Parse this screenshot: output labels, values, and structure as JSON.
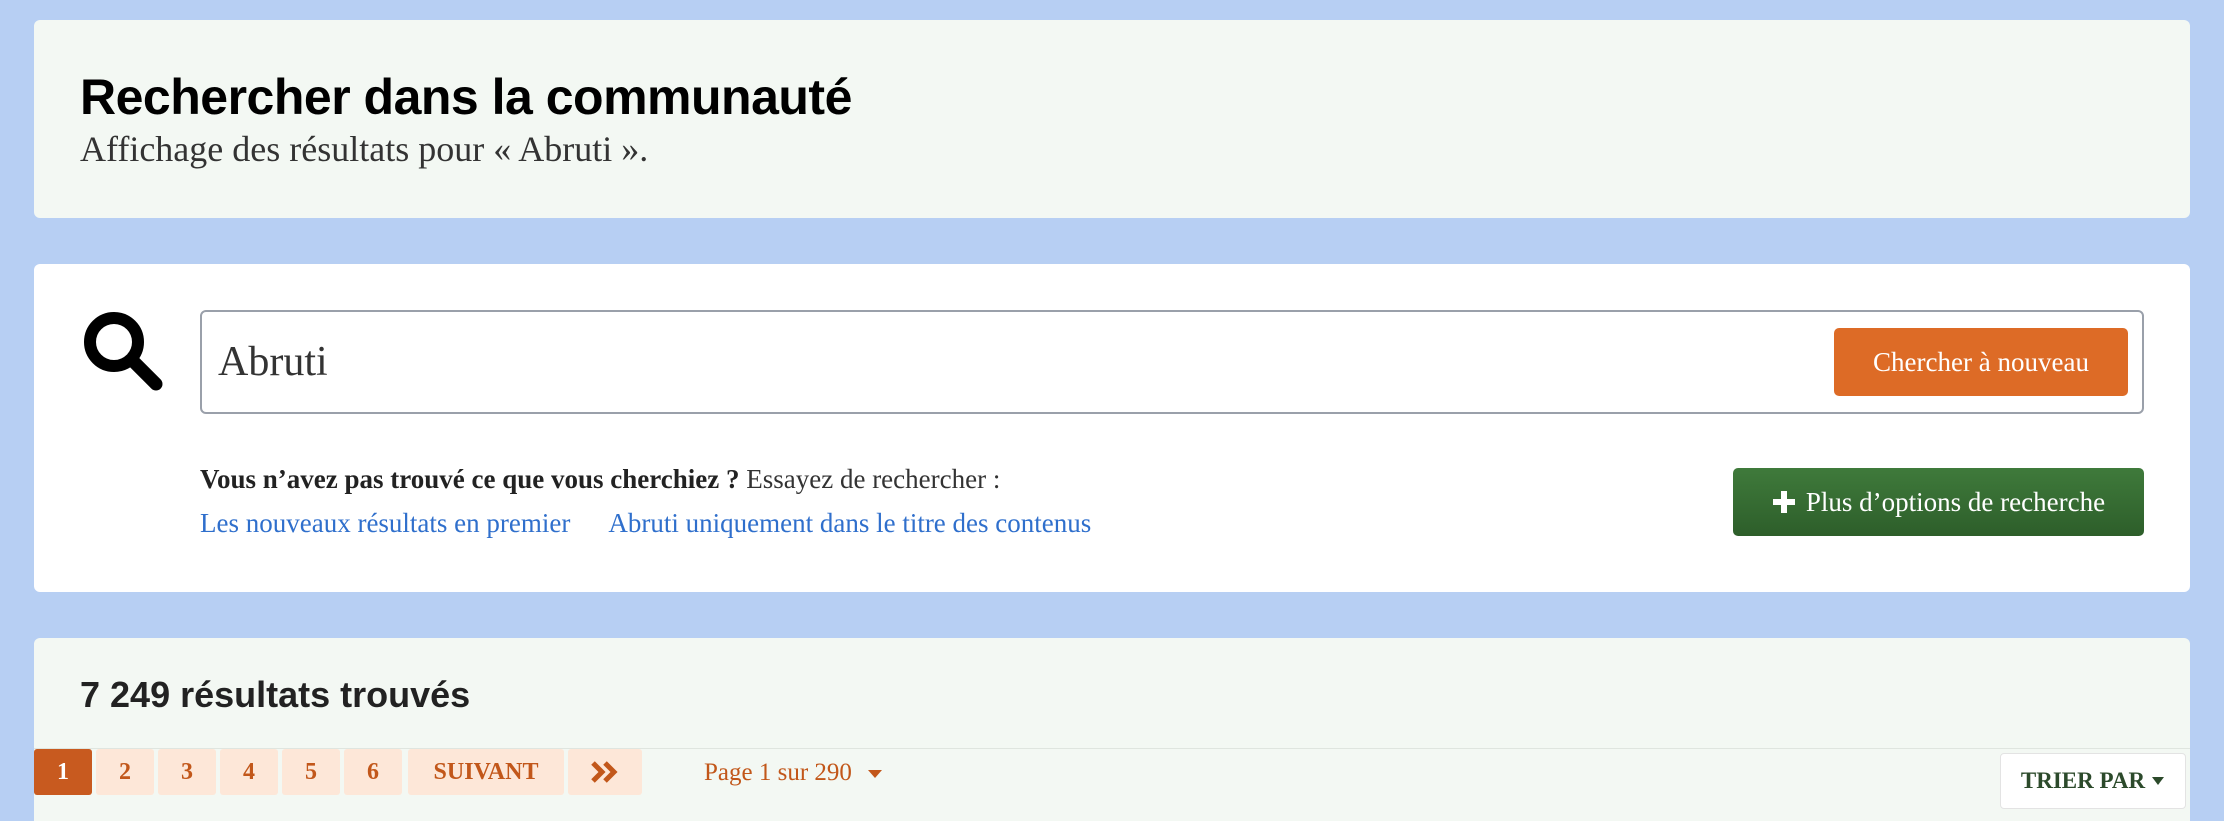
{
  "header": {
    "title": "Rechercher dans la communauté",
    "subtitle": "Affichage des résultats pour « Abruti »."
  },
  "search": {
    "value": "Abruti",
    "search_again_label": "Chercher à nouveau",
    "hint_bold": "Vous n’avez pas trouvé ce que vous cherchiez ?",
    "hint_rest": " Essayez de rechercher :",
    "links": [
      "Les nouveaux résultats en premier",
      "Abruti uniquement dans le titre des contenus"
    ],
    "more_options_label": "Plus d’options de recherche"
  },
  "results": {
    "count_label": "7 249 résultats trouvés",
    "pages": [
      "1",
      "2",
      "3",
      "4",
      "5",
      "6"
    ],
    "current_page": "1",
    "next_label": "SUIVANT",
    "page_info": "Page 1 sur 290",
    "sort_label": "TRIER PAR"
  },
  "colors": {
    "background": "#b7cff3",
    "accent_orange": "#dd6b26",
    "accent_green": "#3f7a3b",
    "link_blue": "#2f6fcc"
  },
  "icons": [
    "search-icon",
    "plus-icon",
    "double-chevron-right-icon",
    "caret-down-icon"
  ]
}
